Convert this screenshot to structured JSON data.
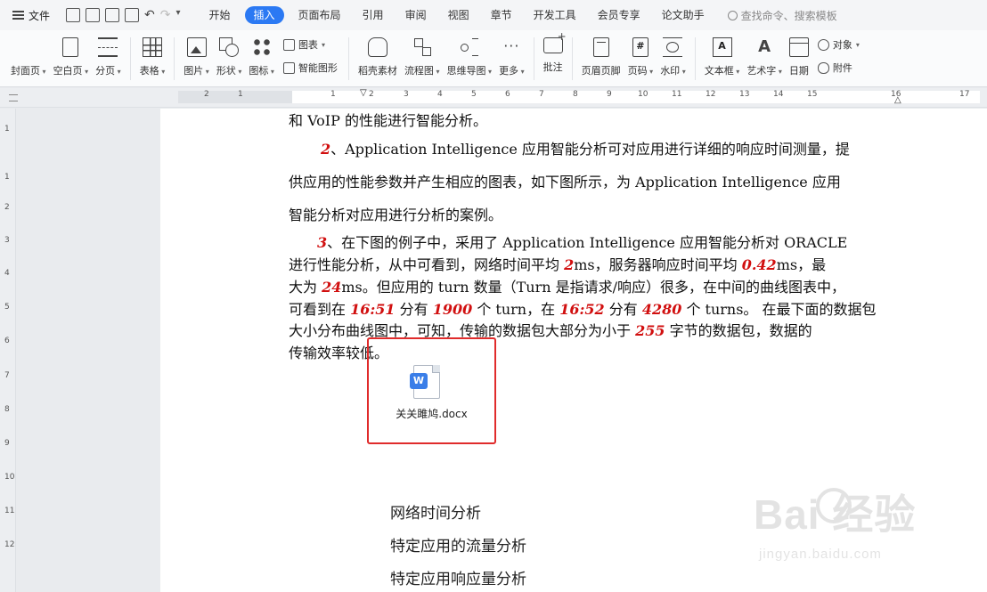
{
  "menubar": {
    "file_label": "文件",
    "tabs": [
      "开始",
      "插入",
      "页面布局",
      "引用",
      "审阅",
      "视图",
      "章节",
      "开发工具",
      "会员专享",
      "论文助手"
    ],
    "active_tab": "插入",
    "search_placeholder": "查找命令、搜索模板"
  },
  "ribbon": {
    "cover": "封面页",
    "blank": "空白页",
    "pagebreak": "分页",
    "table": "表格",
    "picture": "图片",
    "shape": "形状",
    "icon": "图标",
    "chart": "图表",
    "smartart": "智能图形",
    "material": "稻壳素材",
    "flowchart": "流程图",
    "mindmap": "思维导图",
    "more": "更多",
    "comment": "批注",
    "header_footer": "页眉页脚",
    "page_number": "页码",
    "watermark": "水印",
    "textbox": "文本框",
    "wordart": "艺术字",
    "date": "日期",
    "object": "对象",
    "attachment": "附件"
  },
  "ruler": {
    "numbers": [
      "2",
      "1",
      "1",
      "2",
      "3",
      "4",
      "5",
      "6",
      "7",
      "8",
      "9",
      "10",
      "11",
      "12",
      "13",
      "14",
      "15",
      "16",
      "17"
    ]
  },
  "vruler": {
    "numbers": [
      "1",
      "1",
      "2",
      "3",
      "4",
      "5",
      "6",
      "7",
      "8",
      "9",
      "10",
      "11",
      "12"
    ]
  },
  "document": {
    "line0": "和 VoIP 的性能进行智能分析。",
    "p2_num": "2",
    "p2_l1": "、Application Intelligence 应用智能分析可对应用进行详细的响应时间测量，提",
    "p2_l2": "供应用的性能参数并产生相应的图表，如下图所示，为 Application Intelligence 应用",
    "p2_l3": "智能分析对应用进行分析的案例。",
    "p3_num": "3",
    "p3_l1": "、在下图的例子中，采用了 Application Intelligence 应用智能分析对 ORACLE",
    "p3_l2a": "进行性能分析，从中可看到，网络时间平均 ",
    "p3_l2_v1": "2",
    "p3_l2b": "ms，服务器响应时间平均 ",
    "p3_l2_v2": "0.42",
    "p3_l2c": "ms，最",
    "p3_l3a": "大为 ",
    "p3_l3_v": "24",
    "p3_l3b": "ms。但应用的 turn 数量（Turn 是指请求/响应）很多，在中间的曲线图表中，",
    "p3_l4a": "可看到在 ",
    "p3_l4_t1": "16:51",
    "p3_l4b": " 分有 ",
    "p3_l4_n1": "1900",
    "p3_l4c": " 个 turn，在 ",
    "p3_l4_t2": "16:52",
    "p3_l4d": " 分有 ",
    "p3_l4_n2": "4280",
    "p3_l4e": " 个 turns。 在最下面的数据包",
    "p3_l5a": "大小分布曲线图中，可知，传输的数据包大部分为小于 ",
    "p3_l5_v": "255",
    "p3_l5b": " 字节的数据包，数据的",
    "p3_l6": "传输效率较低。",
    "attachment_name": "关关雎鸠.docx",
    "attachment_badge": "W",
    "toc": [
      "网络时间分析",
      "特定应用的流量分析",
      "特定应用响应量分析"
    ]
  },
  "watermark": {
    "brand": "Bai  经验",
    "url": "jingyan.baidu.com"
  },
  "colors": {
    "accent": "#2b79f3",
    "highlight": "#d10f0f",
    "selection_box": "#e02b2b"
  }
}
